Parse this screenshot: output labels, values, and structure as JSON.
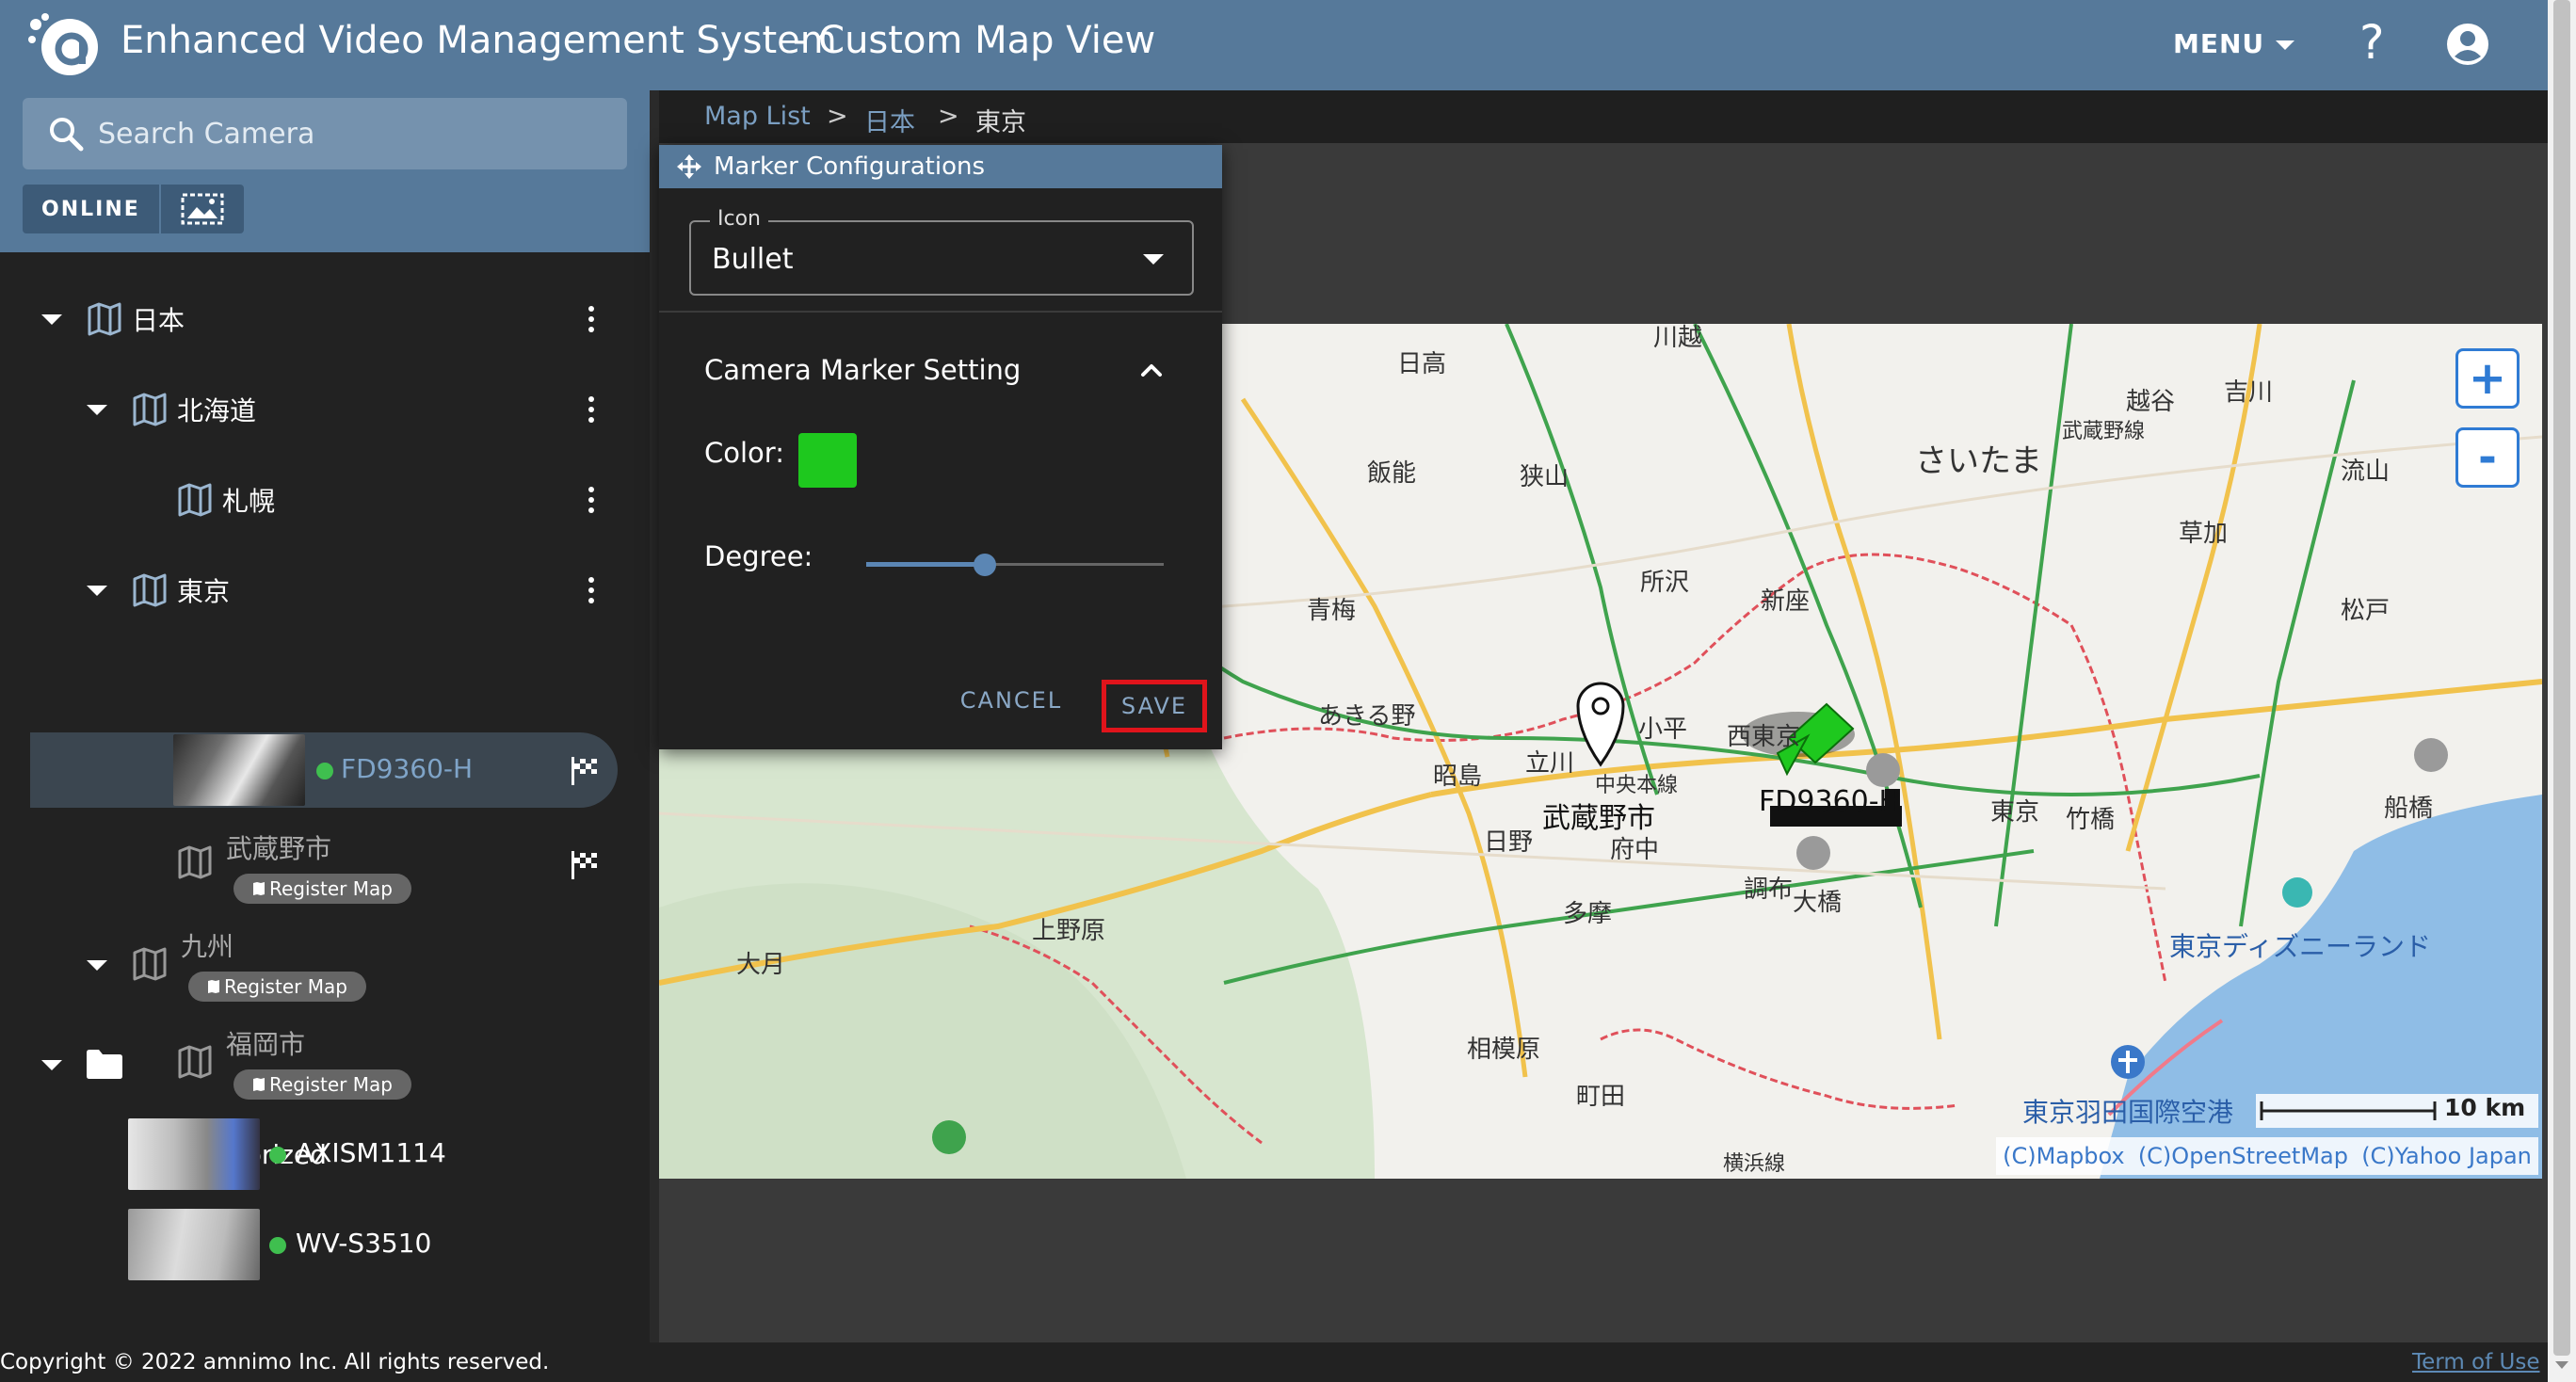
{
  "header": {
    "app_title": "Enhanced Video Management System",
    "page_subtitle": "- Custom Map View",
    "menu_label": "MENU",
    "help_glyph": "?",
    "logo_icon": "amnimo-logo-icon",
    "account_icon": "account-circle-icon"
  },
  "sidebar": {
    "search_placeholder": "Search Camera",
    "filters": [
      "ONLINE"
    ],
    "filter_icon": "image-grid-icon",
    "tree": {
      "japan": "日本",
      "hokkaido": "北海道",
      "sapporo": "札幌",
      "tokyo": "東京",
      "musashino": "武蔵野市",
      "kyushu": "九州",
      "fukuoka": "福岡市",
      "uncategorized": "Uncategorized",
      "register_map_label": "Register Map"
    },
    "cameras": {
      "selected": "FD9360-H",
      "uncategorized": [
        "AXISM1114",
        "WV-S3510"
      ]
    }
  },
  "breadcrumb": {
    "items": [
      "Map List",
      "日本",
      "東京"
    ],
    "separator": ">"
  },
  "marker_config": {
    "title": "Marker Configurations",
    "icon_field_label": "Icon",
    "icon_value": "Bullet",
    "section_title": "Camera Marker Setting",
    "color_label": "Color:",
    "color_value": "#1ec81e",
    "degree_label": "Degree:",
    "degree_fraction": 0.4,
    "cancel_label": "CANCEL",
    "save_label": "SAVE"
  },
  "map": {
    "labels": {
      "hidaka": "日高",
      "kawagoe": "川越",
      "koshigaya": "越谷",
      "yoshikawa": "吉川",
      "saitama": "さいたま",
      "musashino_line": "武蔵野線",
      "hanno": "飯能",
      "sayama": "狭山",
      "nagareyama": "流山",
      "soka": "草加",
      "tokorozawa": "所沢",
      "niiza": "新座",
      "ome": "青梅",
      "matsudo": "松戸",
      "akiruno": "あきる野",
      "kodaira": "小平",
      "nishitokyo": "西東京",
      "tachikawa": "立川",
      "akishima": "昭島",
      "chuo_line": "中央本線",
      "tokyo_station": "東京",
      "takebashi": "竹橋",
      "funabashi": "船橋",
      "hino": "日野",
      "fuchu": "府中",
      "chofu": "調布",
      "ohashi": "大橋",
      "tama": "多摩",
      "kaminohara": "上野原",
      "otsuki": "大月",
      "disneyland": "東京ディズニーランド",
      "sagamihara": "相模原",
      "machida": "町田",
      "haneda": "東京羽田国際空港",
      "yokohama_line": "横浜線"
    },
    "pin_labels": {
      "musashino": "武蔵野市",
      "camera": "FD9360-H"
    },
    "zoom_in": "+",
    "zoom_out": "-",
    "scale_label": "10 km",
    "attribution": [
      "(C)Mapbox",
      "(C)OpenStreetMap",
      "(C)Yahoo Japan"
    ]
  },
  "footer": {
    "copyright": "Copyright © 2022 amnimo Inc. All rights reserved.",
    "terms": "Term of Use"
  }
}
